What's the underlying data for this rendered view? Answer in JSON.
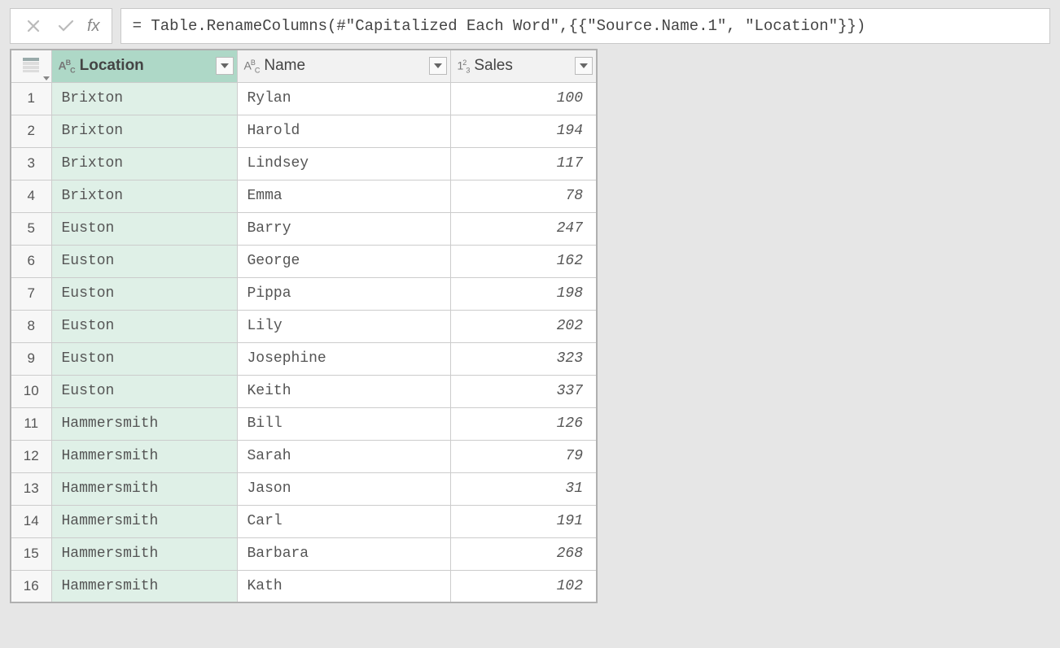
{
  "formula_bar": {
    "fx_label": "fx",
    "value": "= Table.RenameColumns(#\"Capitalized Each Word\",{{\"Source.Name.1\", \"Location\"}})"
  },
  "columns": [
    {
      "label": "Location",
      "type_badge": "ABC",
      "type": "text",
      "selected": true
    },
    {
      "label": "Name",
      "type_badge": "ABC",
      "type": "text",
      "selected": false
    },
    {
      "label": "Sales",
      "type_badge": "123",
      "type": "number",
      "selected": false
    }
  ],
  "rows": [
    {
      "n": 1,
      "location": "Brixton",
      "name": "Rylan",
      "sales": 100
    },
    {
      "n": 2,
      "location": "Brixton",
      "name": "Harold",
      "sales": 194
    },
    {
      "n": 3,
      "location": "Brixton",
      "name": "Lindsey",
      "sales": 117
    },
    {
      "n": 4,
      "location": "Brixton",
      "name": "Emma",
      "sales": 78
    },
    {
      "n": 5,
      "location": "Euston",
      "name": "Barry",
      "sales": 247
    },
    {
      "n": 6,
      "location": "Euston",
      "name": "George",
      "sales": 162
    },
    {
      "n": 7,
      "location": "Euston",
      "name": "Pippa",
      "sales": 198
    },
    {
      "n": 8,
      "location": "Euston",
      "name": "Lily",
      "sales": 202
    },
    {
      "n": 9,
      "location": "Euston",
      "name": "Josephine",
      "sales": 323
    },
    {
      "n": 10,
      "location": "Euston",
      "name": "Keith",
      "sales": 337
    },
    {
      "n": 11,
      "location": "Hammersmith",
      "name": "Bill",
      "sales": 126
    },
    {
      "n": 12,
      "location": "Hammersmith",
      "name": "Sarah",
      "sales": 79
    },
    {
      "n": 13,
      "location": "Hammersmith",
      "name": "Jason",
      "sales": 31
    },
    {
      "n": 14,
      "location": "Hammersmith",
      "name": "Carl",
      "sales": 191
    },
    {
      "n": 15,
      "location": "Hammersmith",
      "name": "Barbara",
      "sales": 268
    },
    {
      "n": 16,
      "location": "Hammersmith",
      "name": "Kath",
      "sales": 102
    }
  ]
}
